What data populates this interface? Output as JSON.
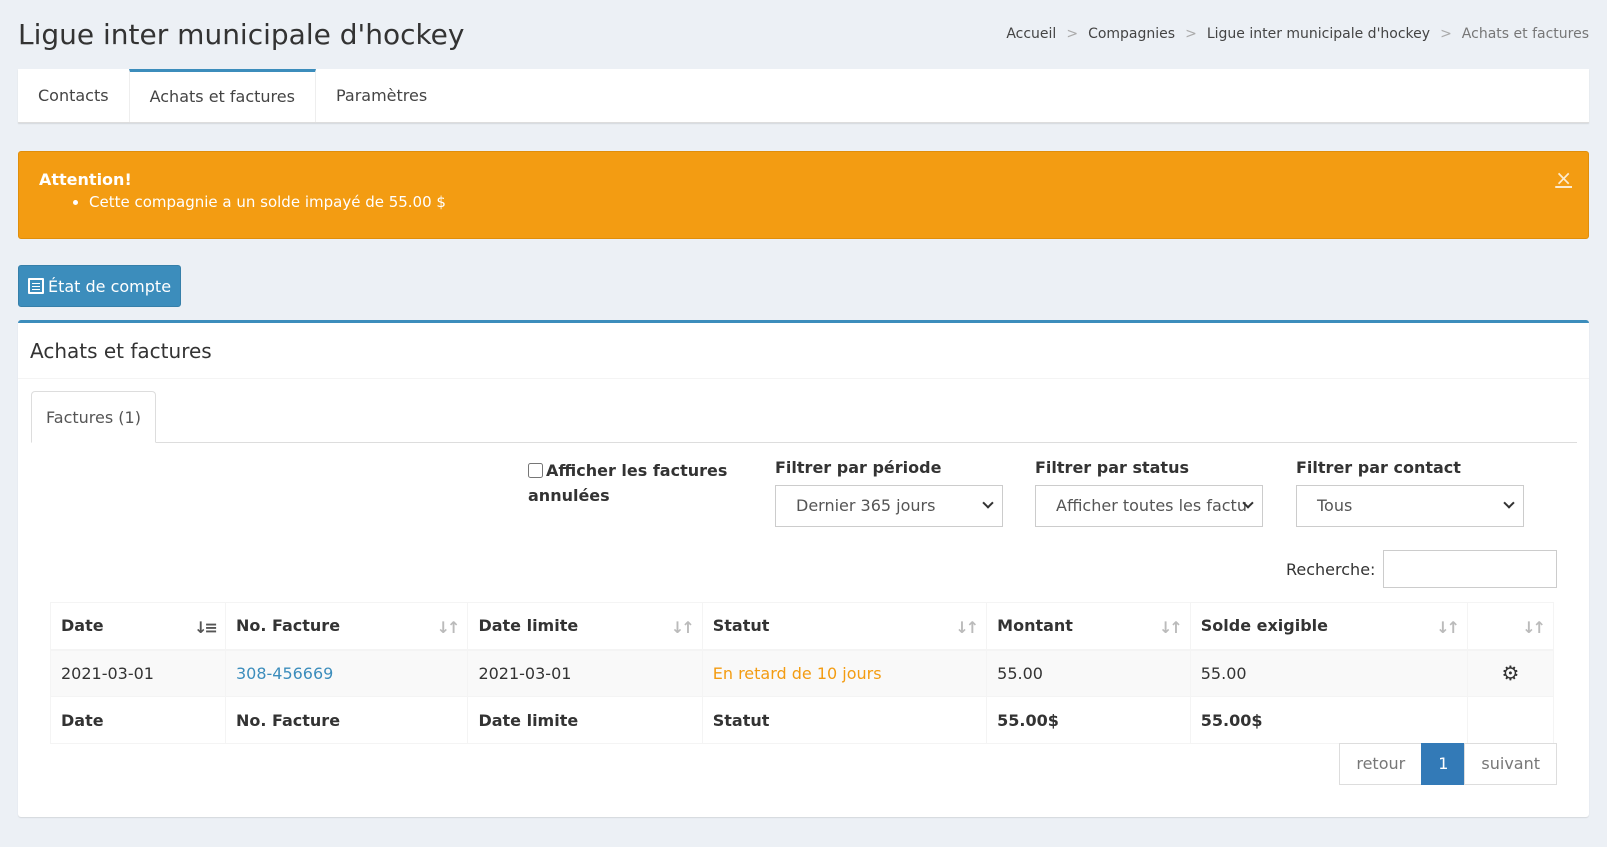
{
  "page": {
    "title": "Ligue inter municipale d'hockey",
    "breadcrumb": [
      "Accueil",
      "Compagnies",
      "Ligue inter municipale d'hockey",
      "Achats et factures"
    ]
  },
  "top_tabs": [
    "Contacts",
    "Achats et factures",
    "Paramètres"
  ],
  "alert": {
    "title": "Attention!",
    "message": "Cette compagnie a un solde impayé de 55.00 $",
    "close": "×",
    "color": "#f39c12"
  },
  "account_button": {
    "label": "État de compte"
  },
  "box": {
    "title": "Achats et factures",
    "inner_tab": "Factures (1)"
  },
  "filters": {
    "cancelled_label": "Afficher les factures annulées",
    "period_label": "Filtrer par période",
    "period_value": "Dernier 365 jours",
    "status_label": "Filtrer par status",
    "status_value": "Afficher toutes les factu",
    "contact_label": "Filtrer par contact",
    "contact_value": "Tous",
    "search_label": "Recherche:"
  },
  "table": {
    "columns": [
      "Date",
      "No. Facture",
      "Date limite",
      "Statut",
      "Montant",
      "Solde exigible",
      ""
    ],
    "rows": [
      {
        "date": "2021-03-01",
        "invoice": "308-456669",
        "due": "2021-03-01",
        "status": "En retard de 10 jours",
        "amount": "55.00",
        "balance": "55.00"
      }
    ],
    "footer": {
      "date": "Date",
      "invoice": "No. Facture",
      "due": "Date limite",
      "status": "Statut",
      "amount": "55.00$",
      "balance": "55.00$"
    }
  },
  "pagination": {
    "prev": "retour",
    "current": "1",
    "next": "suivant"
  }
}
